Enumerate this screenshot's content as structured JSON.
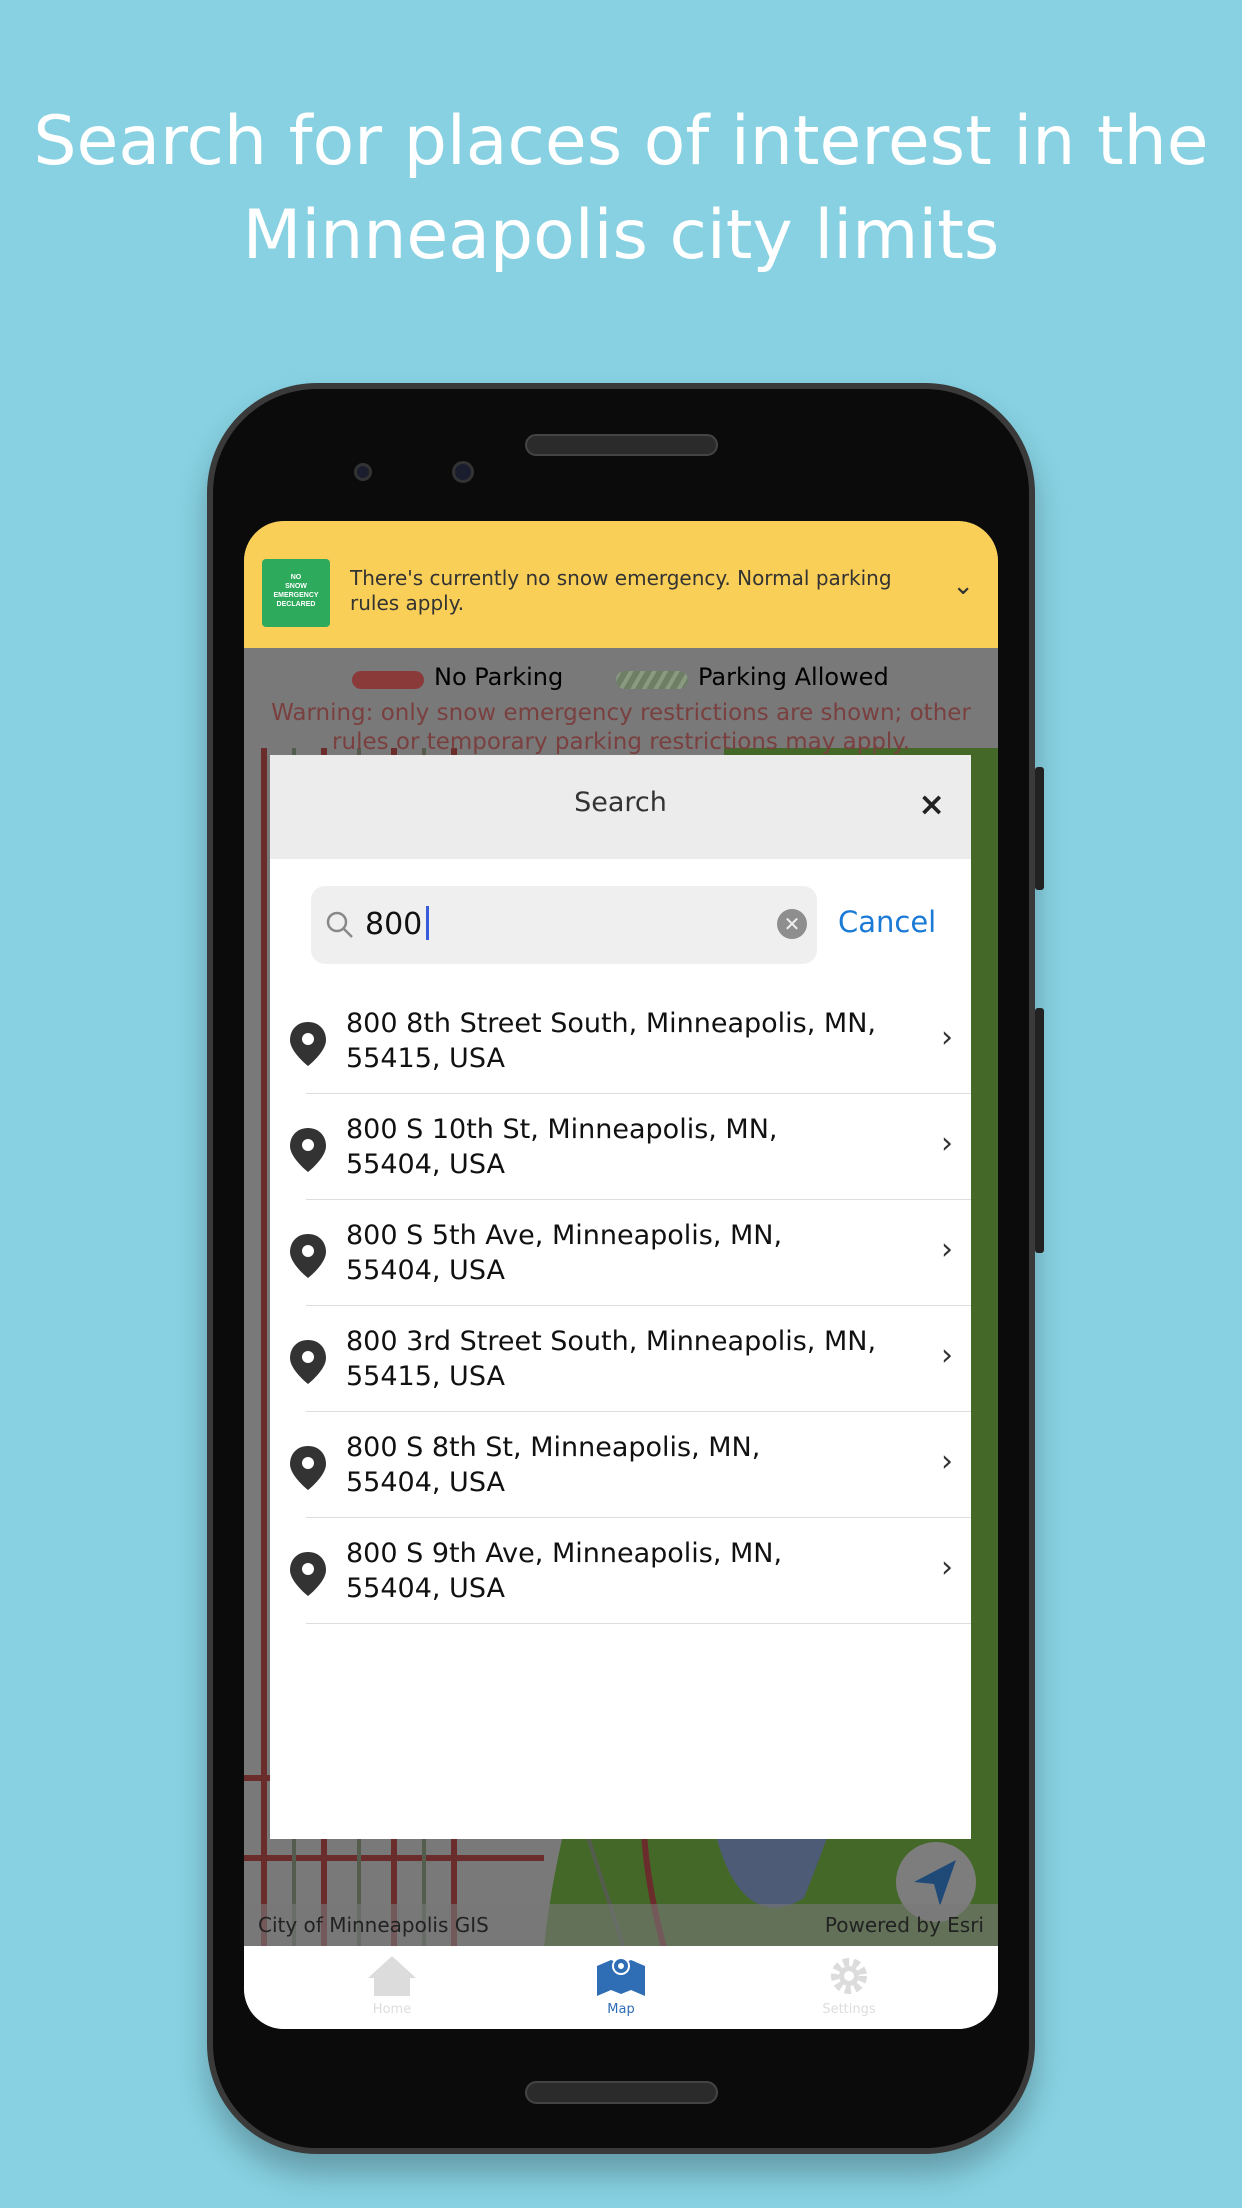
{
  "headline": {
    "line1": "Search for places of interest in the",
    "line2": "Minneapolis city limits"
  },
  "banner": {
    "sign_text": [
      "NO",
      "SNOW",
      "EMERGENCY",
      "DECLARED"
    ],
    "message": "There's currently no snow emergency. Normal parking rules apply.",
    "icon": "chevron-down-icon"
  },
  "legend": {
    "no_parking": "No Parking",
    "parking_allowed": "Parking Allowed",
    "no_parking_color": "#8b3a3a",
    "parking_allowed_color": "#6d7d66"
  },
  "warning": "Warning: only snow emergency restrictions are shown; other rules or temporary parking restrictions may apply.",
  "search": {
    "title": "Search",
    "close": "×",
    "query": "800",
    "cancel_label": "Cancel",
    "results": [
      {
        "line1": "800 8th Street South, Minneapolis, MN,",
        "line2": "55415, USA"
      },
      {
        "line1": "800 S 10th St, Minneapolis, MN,",
        "line2": "55404, USA"
      },
      {
        "line1": "800 S 5th Ave, Minneapolis, MN,",
        "line2": "55404, USA"
      },
      {
        "line1": "800 3rd Street South, Minneapolis, MN,",
        "line2": "55415, USA"
      },
      {
        "line1": "800 S 8th St, Minneapolis, MN,",
        "line2": "55404, USA"
      },
      {
        "line1": "800 S 9th Ave, Minneapolis, MN,",
        "line2": "55404, USA"
      }
    ]
  },
  "map": {
    "attribution_left": "City of Minneapolis GIS",
    "attribution_right": "Powered by Esri"
  },
  "tabs": [
    {
      "label": "Home",
      "icon": "home-icon",
      "active": false
    },
    {
      "label": "Map",
      "icon": "map-icon",
      "active": true
    },
    {
      "label": "Settings",
      "icon": "gear-icon",
      "active": false
    }
  ],
  "colors": {
    "background": "#87d1e2",
    "banner": "#f9cf57",
    "accent": "#1a7ad6",
    "tab_active": "#2f6db5"
  }
}
